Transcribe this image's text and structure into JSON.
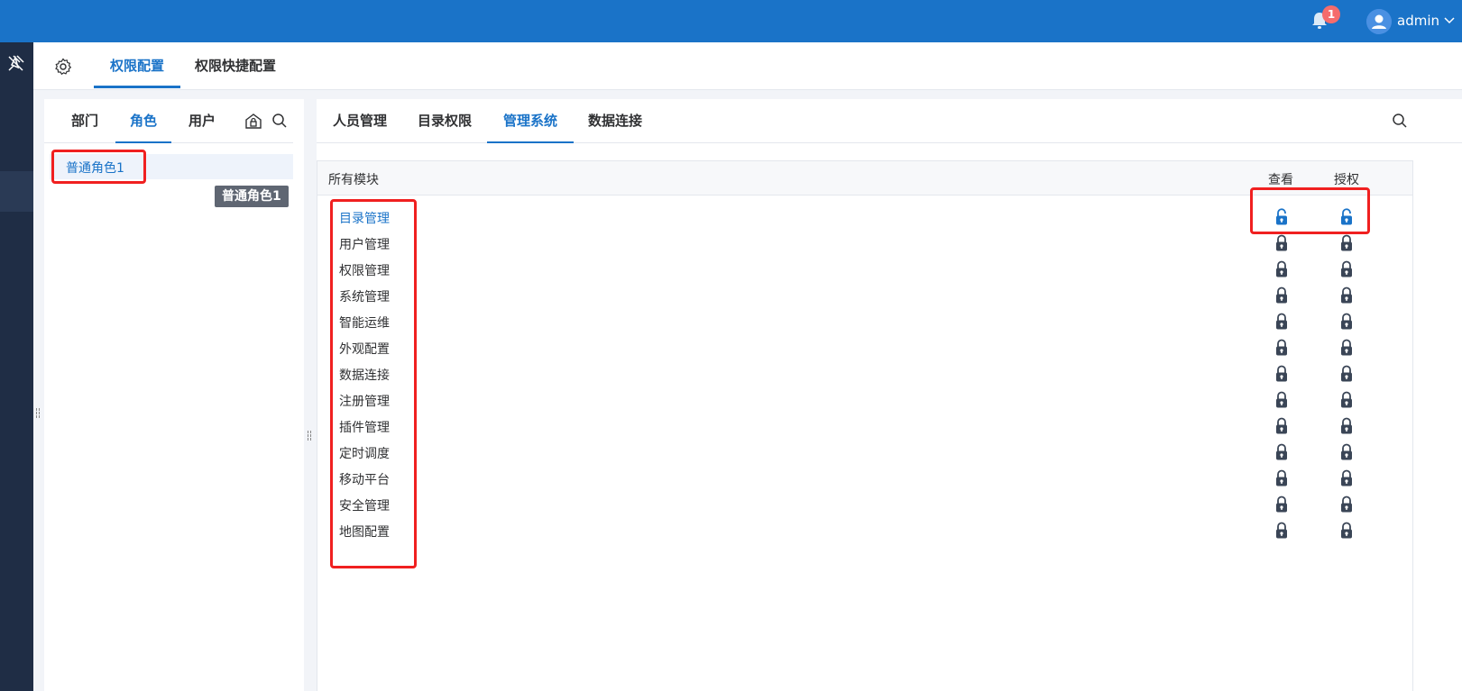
{
  "header": {
    "notification_count": "1",
    "username": "admin",
    "brand_color": "#1a73c8"
  },
  "top_tabs": [
    {
      "label": "权限配置",
      "active": true
    },
    {
      "label": "权限快捷配置",
      "active": false
    }
  ],
  "left_panel": {
    "tabs": [
      {
        "label": "部门",
        "active": false
      },
      {
        "label": "角色",
        "active": true
      },
      {
        "label": "用户",
        "active": false
      }
    ],
    "roles": [
      {
        "label": "普通角色1",
        "selected": true
      }
    ],
    "tooltip": "普通角色1"
  },
  "right_panel": {
    "tabs": [
      {
        "label": "人员管理",
        "active": false
      },
      {
        "label": "目录权限",
        "active": false
      },
      {
        "label": "管理系统",
        "active": true
      },
      {
        "label": "数据连接",
        "active": false
      }
    ],
    "table": {
      "header_module": "所有模块",
      "header_view": "查看",
      "header_grant": "授权",
      "rows": [
        {
          "name": "目录管理",
          "active": true,
          "view": "unlocked",
          "grant": "unlocked"
        },
        {
          "name": "用户管理",
          "active": false,
          "view": "locked",
          "grant": "locked"
        },
        {
          "name": "权限管理",
          "active": false,
          "view": "locked",
          "grant": "locked"
        },
        {
          "name": "系统管理",
          "active": false,
          "view": "locked",
          "grant": "locked"
        },
        {
          "name": "智能运维",
          "active": false,
          "view": "locked",
          "grant": "locked"
        },
        {
          "name": "外观配置",
          "active": false,
          "view": "locked",
          "grant": "locked"
        },
        {
          "name": "数据连接",
          "active": false,
          "view": "locked",
          "grant": "locked"
        },
        {
          "name": "注册管理",
          "active": false,
          "view": "locked",
          "grant": "locked"
        },
        {
          "name": "插件管理",
          "active": false,
          "view": "locked",
          "grant": "locked"
        },
        {
          "name": "定时调度",
          "active": false,
          "view": "locked",
          "grant": "locked"
        },
        {
          "name": "移动平台",
          "active": false,
          "view": "locked",
          "grant": "locked"
        },
        {
          "name": "安全管理",
          "active": false,
          "view": "locked",
          "grant": "locked"
        },
        {
          "name": "地图配置",
          "active": false,
          "view": "locked",
          "grant": "locked"
        }
      ]
    }
  },
  "colors": {
    "highlight": "#f02020",
    "locked_icon": "#3a4556",
    "unlocked_icon": "#1a73c8"
  }
}
